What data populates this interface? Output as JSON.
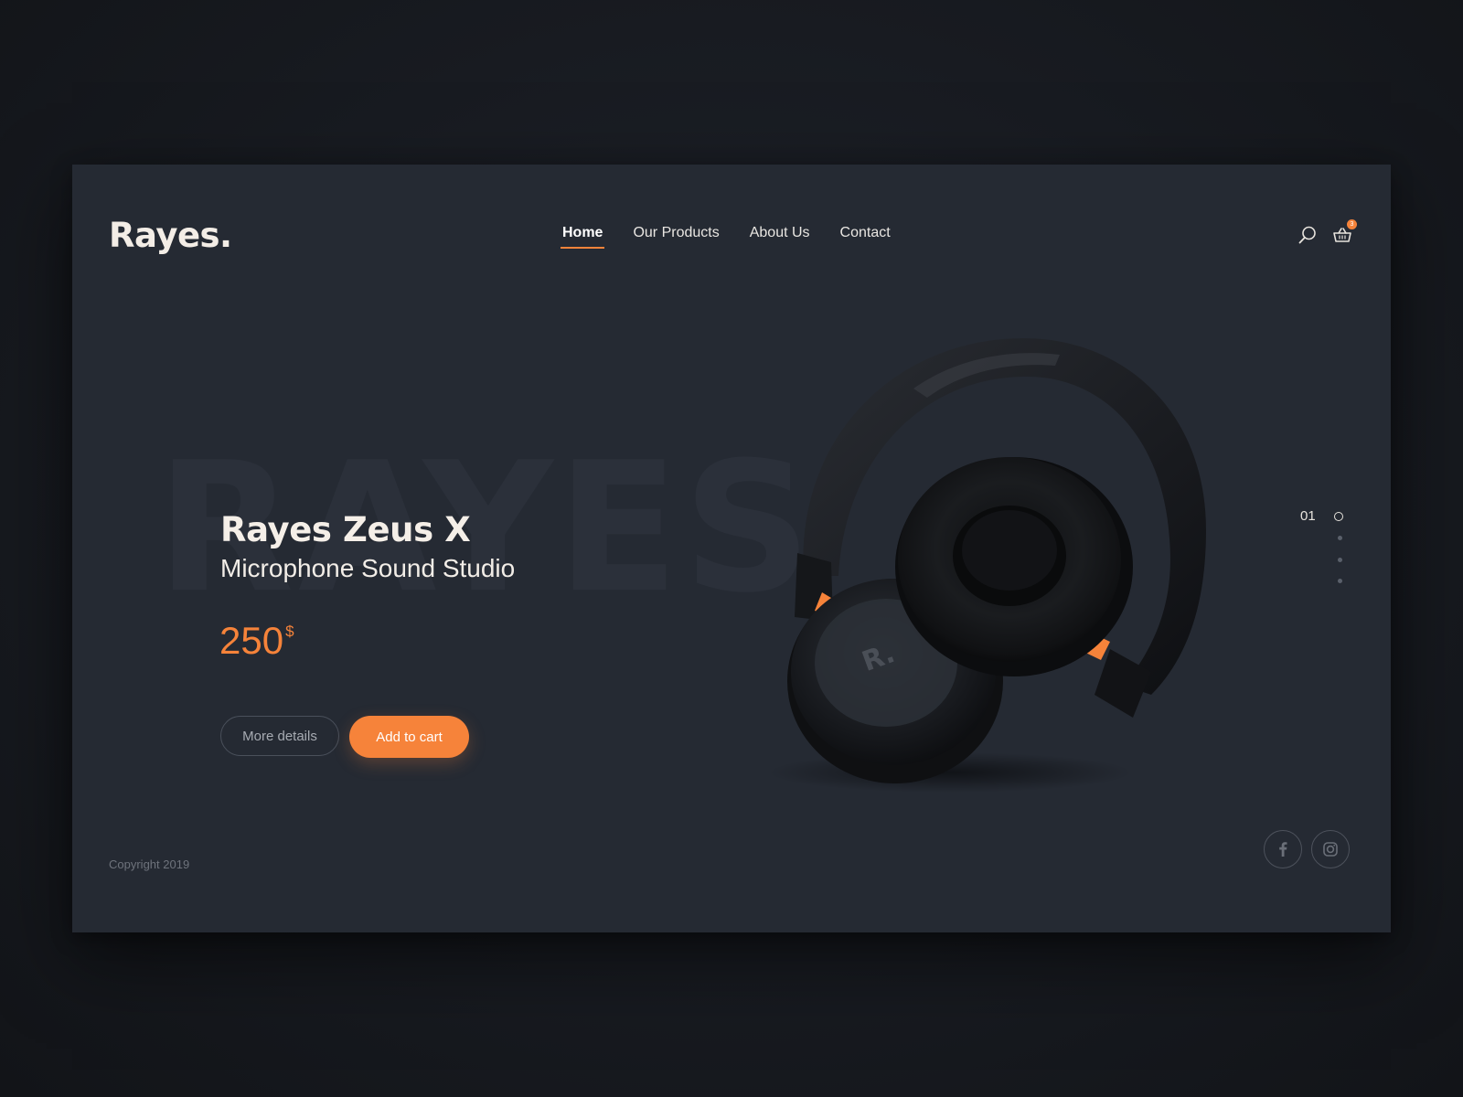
{
  "brand": {
    "logo": "Rayes."
  },
  "nav": {
    "items": [
      "Home",
      "Our Products",
      "About Us",
      "Contact"
    ],
    "active": "Home"
  },
  "header": {
    "cart_count": "3",
    "icons": [
      "search-icon",
      "cart-icon"
    ]
  },
  "hero": {
    "watermark": "RAYES",
    "product_name": "Rayes Zeus X",
    "product_subtitle": "Microphone Sound Studio",
    "price": "250",
    "currency": "$",
    "more_details_label": "More details",
    "add_to_cart_label": "Add to cart",
    "headphone_badge": "R."
  },
  "pager": {
    "current": "01",
    "total_slides": 4,
    "active_index": 1
  },
  "footer": {
    "copyright": "Copyright 2019",
    "social": [
      "facebook-icon",
      "instagram-icon"
    ]
  },
  "colors": {
    "accent": "#f6833a",
    "panel": "#252a33",
    "background": "#181b21",
    "text": "#f3ede6"
  }
}
